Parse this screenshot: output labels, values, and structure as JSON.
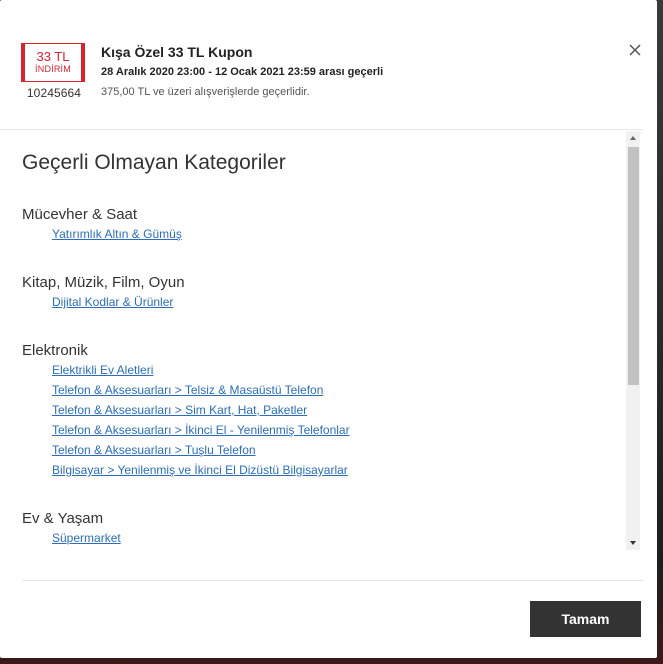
{
  "coupon": {
    "amount": "33 TL",
    "badge_label": "İNDİRİM",
    "code": "10245664",
    "title": "Kışa Özel 33 TL Kupon",
    "dates": "28 Aralık 2020 23:00 - 12 Ocak 2021 23:59 arası geçerli",
    "condition": "375,00 TL ve üzeri alışverişlerde geçerlidir.",
    "accent_color": "#d9232d"
  },
  "section": {
    "title": "Geçerli Olmayan Kategoriler"
  },
  "categories": [
    {
      "name": "Mücevher & Saat",
      "items": [
        "Yatırımlık Altın & Gümüş"
      ]
    },
    {
      "name": "Kitap, Müzik, Film, Oyun",
      "items": [
        "Dijital Kodlar & Ürünler"
      ]
    },
    {
      "name": "Elektronik",
      "items": [
        "Elektrikli Ev Aletleri",
        "Telefon & Aksesuarları > Telsiz & Masaüstü Telefon",
        "Telefon & Aksesuarları > Sim Kart, Hat, Paketler",
        "Telefon & Aksesuarları > İkinci El - Yenilenmiş Telefonlar",
        "Telefon & Aksesuarları > Tuşlu Telefon",
        "Bilgisayar > Yenilenmiş ve İkinci El Dizüstü Bilgisayarlar"
      ]
    },
    {
      "name": "Ev & Yaşam",
      "items": [
        "Süpermarket"
      ]
    }
  ],
  "icons": {
    "close": "close-icon",
    "scroll_up": "chevron-up-icon",
    "scroll_down": "chevron-down-icon"
  },
  "footer": {
    "ok_label": "Tamam"
  },
  "colors": {
    "link": "#2a6ebb",
    "button_bg": "#333333"
  }
}
